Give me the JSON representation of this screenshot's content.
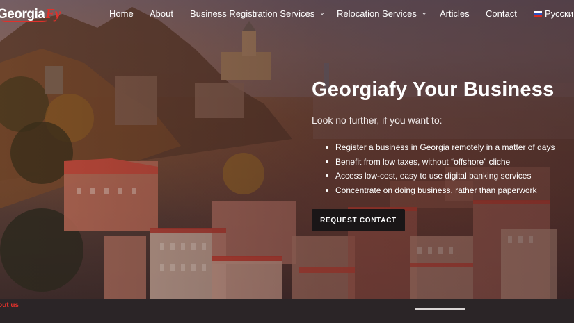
{
  "header": {
    "logo": {
      "text_main": "Georgia",
      "text_accent": "Fy"
    },
    "nav": [
      {
        "label": "Home",
        "has_dropdown": false
      },
      {
        "label": "About",
        "has_dropdown": false
      },
      {
        "label": "Business Registration Services",
        "has_dropdown": true
      },
      {
        "label": "Relocation Services",
        "has_dropdown": true
      },
      {
        "label": "Articles",
        "has_dropdown": false
      },
      {
        "label": "Contact",
        "has_dropdown": false
      }
    ],
    "language": {
      "label": "Русски",
      "flag": "russia-flag-icon"
    }
  },
  "hero": {
    "title": "Georgiafy Your Business",
    "subtitle": "Look no further, if you want to:",
    "bullets": [
      "Register a business in Georgia remotely in a matter of days",
      "Benefit from low taxes, without “offshore” cliche",
      "Access low-cost, easy to use digital banking services",
      "Concentrate on doing business, rather than paperwork"
    ],
    "cta_label": "REQUEST CONTACT"
  },
  "footer_strip": {
    "link_label": "out us"
  },
  "colors": {
    "accent": "#e0312b",
    "cta_bg": "#1a1617",
    "strip_bg": "#2b2527"
  }
}
